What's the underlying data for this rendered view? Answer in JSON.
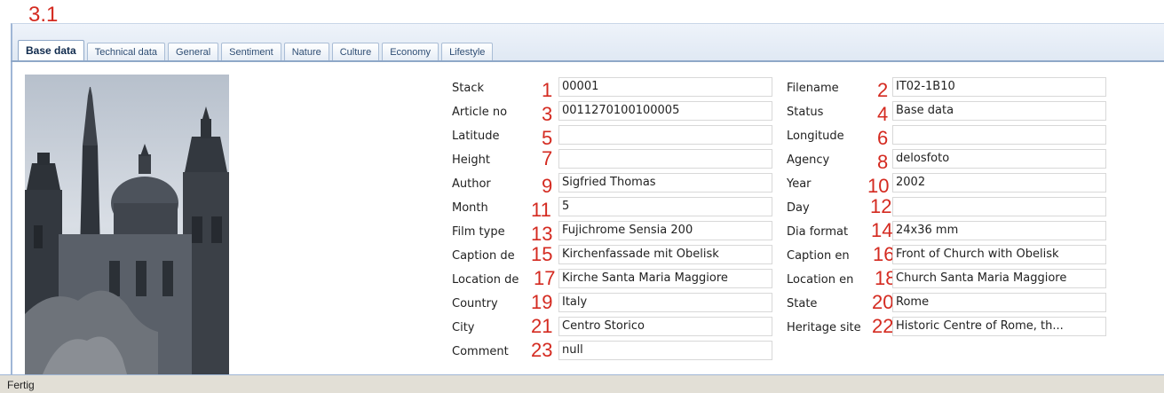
{
  "section_number": "3.1",
  "tabs": [
    {
      "label": "Base data"
    },
    {
      "label": "Technical data"
    },
    {
      "label": "General"
    },
    {
      "label": "Sentiment"
    },
    {
      "label": "Nature"
    },
    {
      "label": "Culture"
    },
    {
      "label": "Economy"
    },
    {
      "label": "Lifestyle"
    }
  ],
  "active_tab": "Base data",
  "fields": [
    {
      "n": "1",
      "label": "Stack",
      "value": "00001"
    },
    {
      "n": "2",
      "label": "Filename",
      "value": "IT02-1B10"
    },
    {
      "n": "3",
      "label": "Article no",
      "value": "0011270100100005"
    },
    {
      "n": "4",
      "label": "Status",
      "value": "Base data"
    },
    {
      "n": "5",
      "label": "Latitude",
      "value": ""
    },
    {
      "n": "6",
      "label": "Longitude",
      "value": ""
    },
    {
      "n": "7",
      "label": "Height",
      "value": ""
    },
    {
      "n": "8",
      "label": "Agency",
      "value": "delosfoto"
    },
    {
      "n": "9",
      "label": "Author",
      "value": "Sigfried Thomas"
    },
    {
      "n": "10",
      "label": "Year",
      "value": "2002"
    },
    {
      "n": "11",
      "label": "Month",
      "value": "5"
    },
    {
      "n": "12",
      "label": "Day",
      "value": ""
    },
    {
      "n": "13",
      "label": "Film type",
      "value": "Fujichrome Sensia 200"
    },
    {
      "n": "14",
      "label": "Dia format",
      "value": "24x36 mm"
    },
    {
      "n": "15",
      "label": "Caption de",
      "value": "Kirchenfassade mit Obelisk"
    },
    {
      "n": "16",
      "label": "Caption en",
      "value": "Front of Church with Obelisk"
    },
    {
      "n": "17",
      "label": "Location de",
      "value": "Kirche Santa Maria Maggiore"
    },
    {
      "n": "18",
      "label": "Location en",
      "value": "Church Santa Maria Maggiore"
    },
    {
      "n": "19",
      "label": "Country",
      "value": "Italy"
    },
    {
      "n": "20",
      "label": "State",
      "value": "Rome"
    },
    {
      "n": "21",
      "label": "City",
      "value": "Centro Storico"
    },
    {
      "n": "22",
      "label": "Heritage site",
      "value": "Historic Centre of Rome, th..."
    },
    {
      "n": "23",
      "label": "Comment",
      "value": "null"
    }
  ],
  "status_bar": "Fertig",
  "colors": {
    "annotation_red": "#d42a20",
    "tab_border": "#8fa8c8",
    "status_bg": "#e2dfd6"
  }
}
